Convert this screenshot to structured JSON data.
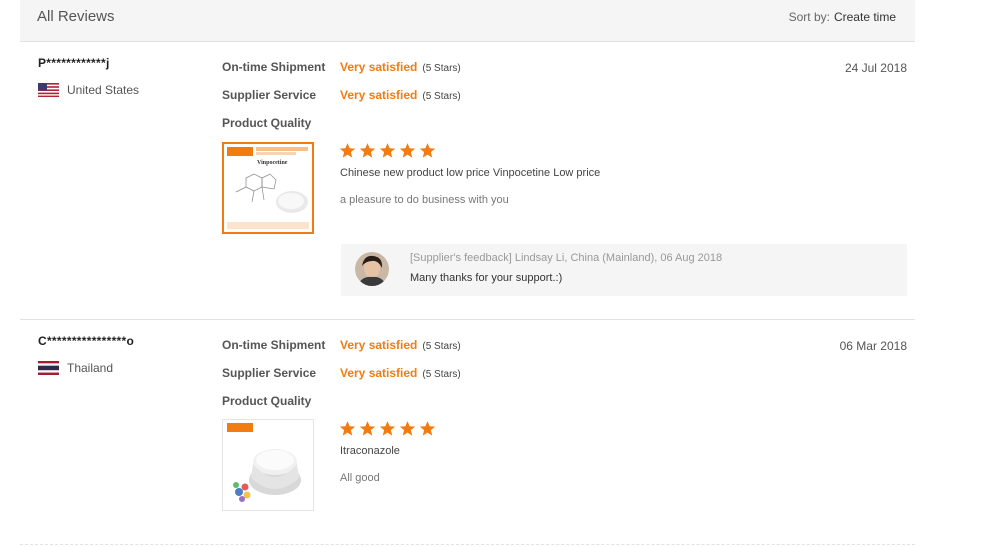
{
  "header": {
    "title": "All Reviews",
    "sort_label": "Sort by:",
    "sort_value": "Create time"
  },
  "colors": {
    "accent": "#f07c12",
    "star": "#f07c12"
  },
  "reviews": [
    {
      "buyer": "P************j",
      "country": "United States",
      "flag_icon": "us-flag-icon",
      "date": "24 Jul 2018",
      "ratings": [
        {
          "label": "On-time Shipment",
          "value": "Very satisfied",
          "stars_text": "(5 Stars)"
        },
        {
          "label": "Supplier Service",
          "value": "Very satisfied",
          "stars_text": "(5 Stars)"
        },
        {
          "label": "Product Quality"
        }
      ],
      "product_stars": 5,
      "product_name": "Chinese new product low price Vinpocetine Low price",
      "thumb_title": "Vinpocetine",
      "comment": "a pleasure to do business with you",
      "feedback": {
        "header": "[Supplier's feedback] Lindsay Li, China (Mainland), 06 Aug 2018",
        "text": "Many thanks for your support.:)"
      }
    },
    {
      "buyer": "C****************o",
      "country": "Thailand",
      "flag_icon": "thailand-flag-icon",
      "date": "06 Mar 2018",
      "ratings": [
        {
          "label": "On-time Shipment",
          "value": "Very satisfied",
          "stars_text": "(5 Stars)"
        },
        {
          "label": "Supplier Service",
          "value": "Very satisfied",
          "stars_text": "(5 Stars)"
        },
        {
          "label": "Product Quality"
        }
      ],
      "product_stars": 5,
      "product_name": "Itraconazole",
      "comment": "All good"
    }
  ]
}
